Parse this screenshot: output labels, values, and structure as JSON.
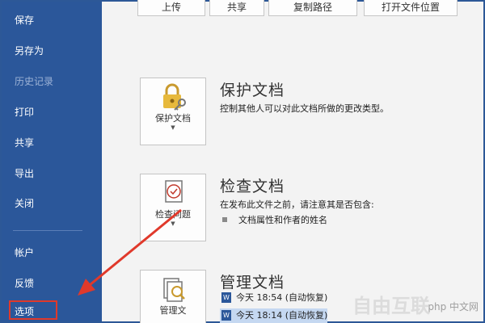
{
  "sidebar": {
    "items": [
      {
        "label": "保存",
        "enabled": true
      },
      {
        "label": "另存为",
        "enabled": true
      },
      {
        "label": "历史记录",
        "enabled": false
      },
      {
        "label": "打印",
        "enabled": true
      },
      {
        "label": "共享",
        "enabled": true
      },
      {
        "label": "导出",
        "enabled": true
      },
      {
        "label": "关闭",
        "enabled": true
      },
      {
        "label": "帐户",
        "enabled": true
      },
      {
        "label": "反馈",
        "enabled": true
      },
      {
        "label": "选项",
        "enabled": true
      }
    ]
  },
  "top_buttons": [
    "上传",
    "共享",
    "复制路径",
    "打开文件位置"
  ],
  "sections": {
    "protect": {
      "title": "保护文档",
      "desc": "控制其他人可以对此文档所做的更改类型。",
      "button_label": "保护文档"
    },
    "inspect": {
      "title": "检查文档",
      "desc": "在发布此文件之前，请注意其是否包含:",
      "bullets": [
        "文档属性和作者的姓名"
      ],
      "button_label": "检查问题"
    },
    "manage": {
      "title": "管理文档",
      "button_label": "管理文",
      "versions": [
        {
          "text": "今天 18:54 (自动恢复)",
          "selected": false
        },
        {
          "text": "今天 18:14 (自动恢复)",
          "selected": true
        }
      ]
    }
  },
  "watermark": {
    "text": "php 中文网",
    "big_text": "自由互联"
  },
  "colors": {
    "sidebar": "#2b579a",
    "highlight": "#e0392b",
    "selected_row": "#c5d8f1"
  }
}
